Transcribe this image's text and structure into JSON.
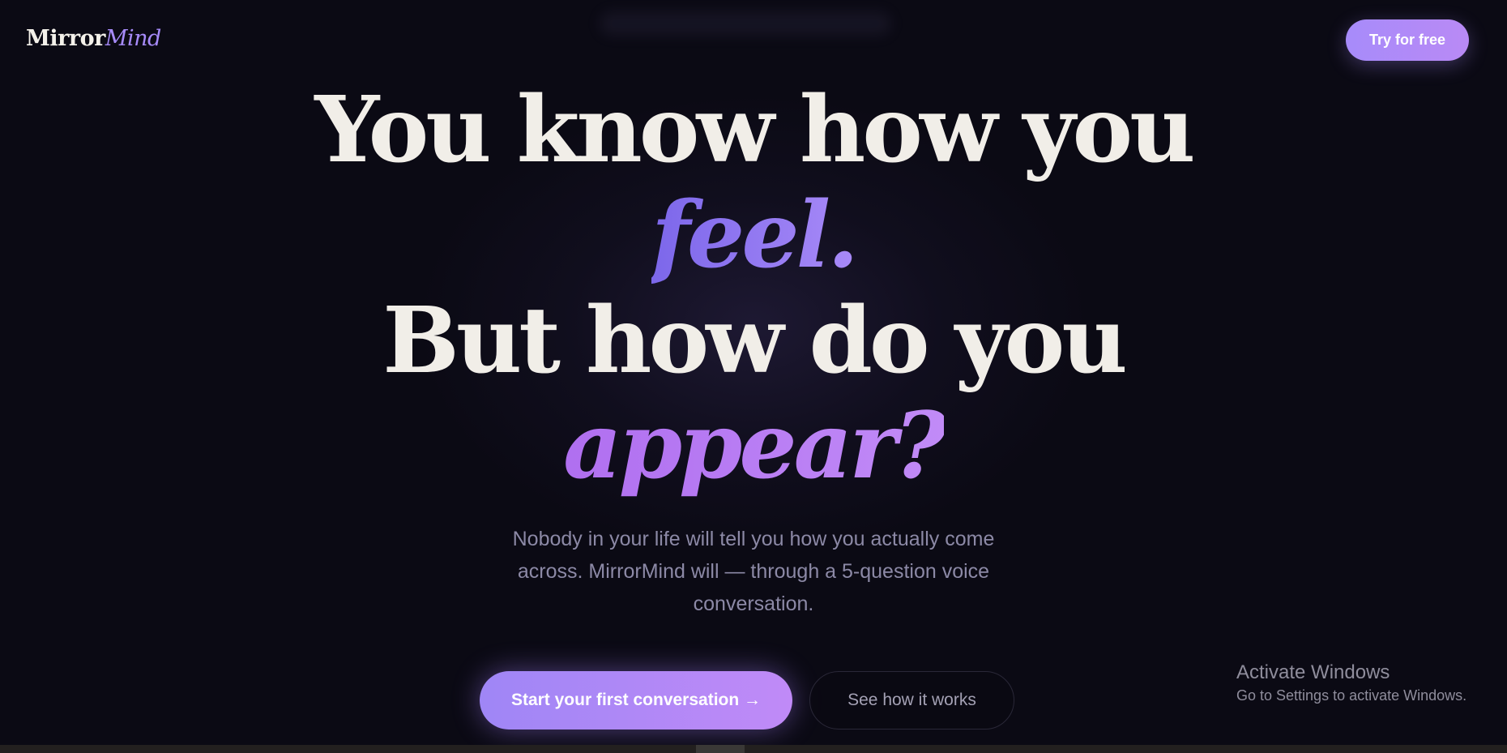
{
  "header": {
    "logo_main": "Mirror",
    "logo_accent": "Mind",
    "try_button": "Try for free"
  },
  "hero": {
    "line1": "You know how you",
    "line2": "feel.",
    "line3": "But how do you",
    "line4": "appear?",
    "subtitle": "Nobody in your life will tell you how you actually come across. MirrorMind will — through a 5-question voice conversation.",
    "primary_cta": "Start your first conversation →",
    "secondary_cta": "See how it works"
  },
  "system_overlay": {
    "title": "Activate Windows",
    "subtitle": "Go to Settings to activate Windows."
  },
  "colors": {
    "background": "#0b0a14",
    "accent_purple": "#a78bfa",
    "accent_violet": "#c08af7",
    "headline_text": "#f1eee8",
    "subtitle_text": "#8c89a6"
  }
}
